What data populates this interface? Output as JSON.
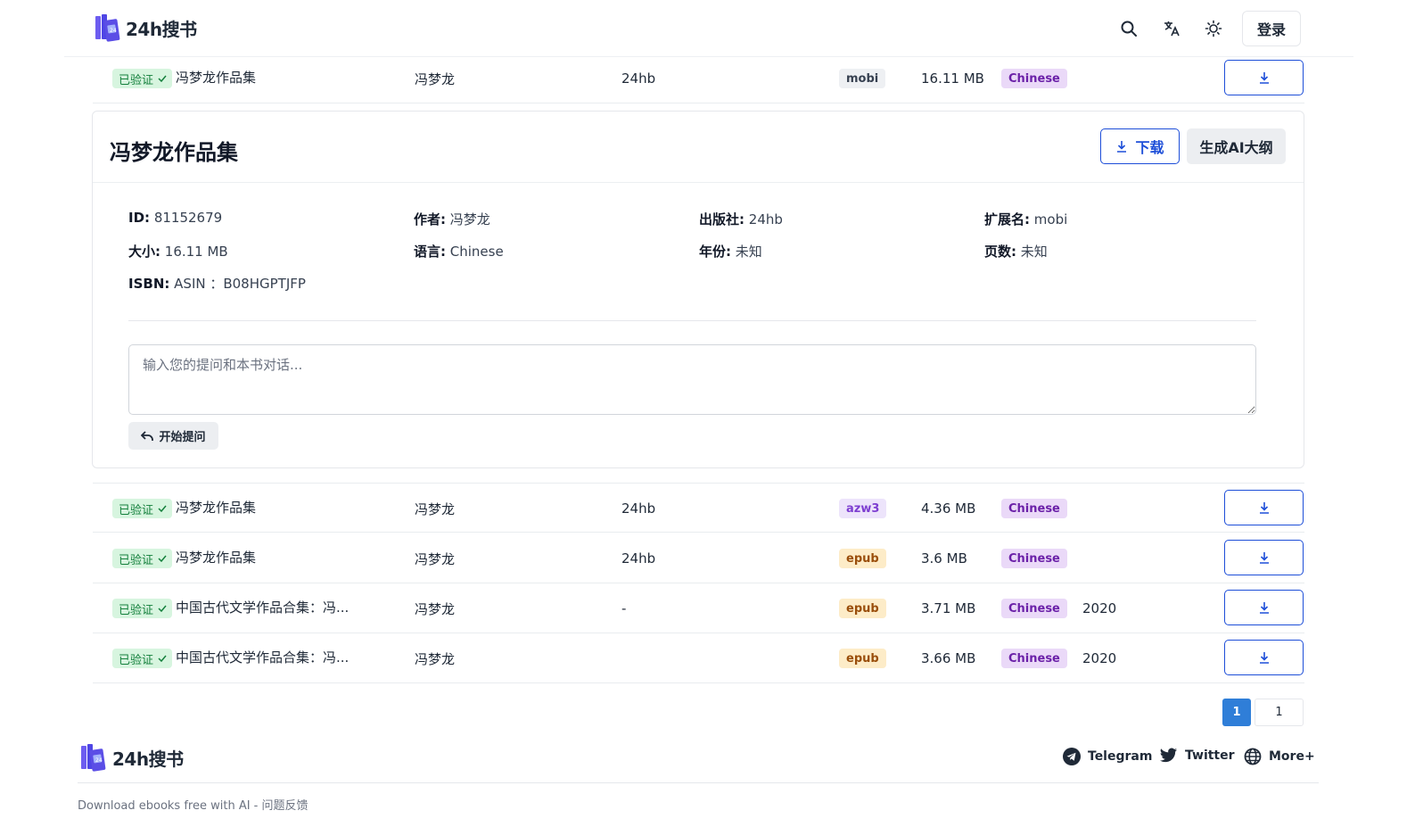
{
  "header": {
    "brand": "24h搜书",
    "login": "登录"
  },
  "columns_note": "",
  "rows": [
    {
      "verified": "已验证",
      "title": "冯梦龙作品集",
      "author": "冯梦龙",
      "publisher": "24hb",
      "ext": "mobi",
      "size": "16.11 MB",
      "lang": "Chinese",
      "year": ""
    },
    {
      "verified": "已验证",
      "title": "冯梦龙作品集",
      "author": "冯梦龙",
      "publisher": "24hb",
      "ext": "azw3",
      "size": "4.36 MB",
      "lang": "Chinese",
      "year": ""
    },
    {
      "verified": "已验证",
      "title": "冯梦龙作品集",
      "author": "冯梦龙",
      "publisher": "24hb",
      "ext": "epub",
      "size": "3.6 MB",
      "lang": "Chinese",
      "year": ""
    },
    {
      "verified": "已验证",
      "title": "中国古代文学作品合集：冯...",
      "author": "冯梦龙",
      "publisher": "-",
      "ext": "epub",
      "size": "3.71 MB",
      "lang": "Chinese",
      "year": "2020"
    },
    {
      "verified": "已验证",
      "title": "中国古代文学作品合集：冯...",
      "author": "冯梦龙",
      "publisher": "",
      "ext": "epub",
      "size": "3.66 MB",
      "lang": "Chinese",
      "year": "2020"
    }
  ],
  "detail": {
    "title": "冯梦龙作品集",
    "download": "下载",
    "ai_outline": "生成AI大纲",
    "id_label": "ID:",
    "id": "81152679",
    "author_label": "作者:",
    "author": "冯梦龙",
    "publisher_label": "出版社:",
    "publisher": "24hb",
    "ext_label": "扩展名:",
    "ext": "mobi",
    "size_label": "大小:",
    "size": "16.11 MB",
    "lang_label": "语言:",
    "lang": "Chinese",
    "year_label": "年份:",
    "year": "未知",
    "pages_label": "页数:",
    "pages": "未知",
    "isbn_label": "ISBN:",
    "isbn": "ASIN ：B08HGPTJFP",
    "ask_placeholder": "输入您的提问和本书对话...",
    "ask_button": "开始提问"
  },
  "pagination": {
    "current": "1",
    "other": "1"
  },
  "footer": {
    "brand": "24h搜书",
    "telegram": "Telegram",
    "twitter": "Twitter",
    "more": "More+",
    "tagline": "Download ebooks free with AI - ",
    "feedback": "问题反馈"
  },
  "colors": {
    "accent": "#1d4ed8",
    "page_active": "#2f7ed8",
    "verified_bg": "#d7f5df",
    "logo": "#5b4ee6"
  }
}
